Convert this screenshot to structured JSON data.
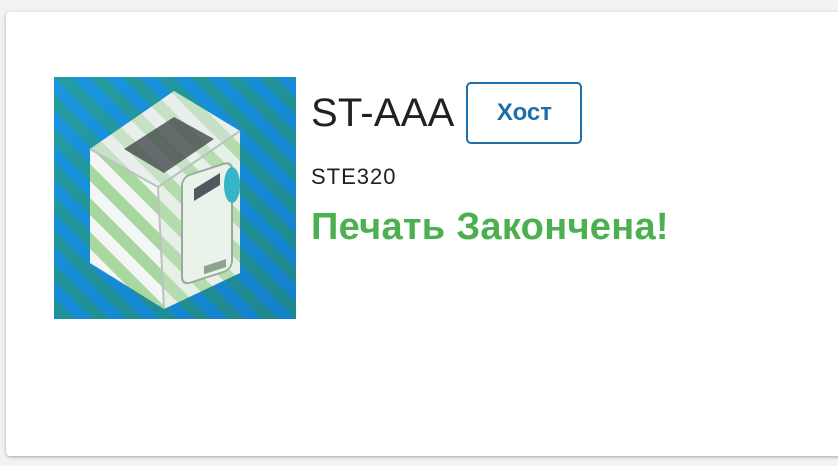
{
  "printer": {
    "name": "ST-AAA",
    "host_label": "Хост",
    "model": "STE320",
    "status": "Печать Закончена!"
  },
  "thumbnail": {
    "icon": "printer-thumbnail",
    "stripe_color_light": "#a8d8a0",
    "stripe_color_dark": "#2c8c5c",
    "background_color": "#1a8ed8"
  },
  "colors": {
    "status": "#4caf50",
    "accent": "#1e6ea7"
  }
}
